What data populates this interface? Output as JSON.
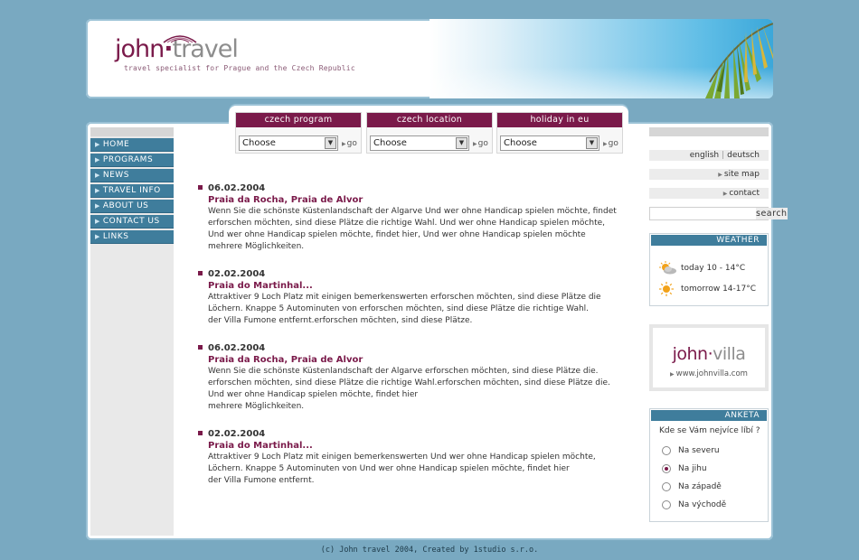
{
  "header": {
    "logo_john": "john",
    "logo_travel": "travel",
    "tagline": "travel specialist for Prague and the Czech Republic"
  },
  "nav": {
    "items": [
      {
        "label": "HOME"
      },
      {
        "label": "PROGRAMS"
      },
      {
        "label": "NEWS"
      },
      {
        "label": "TRAVEL INFO"
      },
      {
        "label": "ABOUT US"
      },
      {
        "label": "CONTACT US"
      },
      {
        "label": "LINKS"
      }
    ]
  },
  "selectors": [
    {
      "title": "czech program",
      "value": "Choose",
      "go": "go"
    },
    {
      "title": "czech location",
      "value": "Choose",
      "go": "go"
    },
    {
      "title": "holiday in eu",
      "value": "Choose",
      "go": "go"
    }
  ],
  "news": [
    {
      "date": "06.02.2004",
      "title": "Praia da Rocha, Praia de Alvor",
      "lines": [
        "Wenn Sie die schönste Küstenlandschaft der Algarve Und wer ohne Handicap spielen möchte, findet",
        "erforschen möchten, sind diese Plätze die richtige Wahl. Und wer ohne Handicap spielen möchte,",
        "Und wer ohne Handicap spielen möchte, findet hier, Und wer ohne Handicap spielen möchte",
        "mehrere Möglichkeiten."
      ]
    },
    {
      "date": "02.02.2004",
      "title": "Praia do Martinhal...",
      "lines": [
        "Attraktiver 9 Loch Platz mit einigen bemerkenswerten erforschen möchten, sind diese Plätze die",
        "Löchern. Knappe 5 Autominuten von erforschen möchten, sind diese Plätze die richtige Wahl.",
        "der Villa Fumone entfernt.erforschen möchten, sind diese Plätze."
      ]
    },
    {
      "date": "06.02.2004",
      "title": "Praia da Rocha, Praia de Alvor",
      "lines": [
        "Wenn Sie die schönste Küstenlandschaft der Algarve erforschen möchten, sind diese Plätze die.",
        "erforschen möchten, sind diese Plätze die richtige Wahl.erforschen möchten, sind diese Plätze die.",
        "Und wer ohne Handicap spielen möchte, findet hier",
        "mehrere Möglichkeiten."
      ]
    },
    {
      "date": "02.02.2004",
      "title": "Praia do Martinhal...",
      "lines": [
        "Attraktiver 9 Loch Platz mit einigen bemerkenswerten Und wer ohne Handicap spielen möchte,",
        "Löchern. Knappe 5 Autominuten von Und wer ohne Handicap spielen möchte, findet hier",
        "der Villa Fumone entfernt."
      ]
    }
  ],
  "right": {
    "lang_en": "english",
    "lang_sep": "|",
    "lang_de": "deutsch",
    "sitemap": "site map",
    "contact": "contact",
    "search_label": "search",
    "search_value": ""
  },
  "weather": {
    "title": "WEATHER",
    "rows": [
      {
        "text": "today 10 - 14°C",
        "icon": "partly-cloudy-icon"
      },
      {
        "text": "tomorrow 14-17°C",
        "icon": "sun-icon"
      }
    ]
  },
  "villa": {
    "logo_john": "john",
    "logo_villa": "villa",
    "url": "www.johnvilla.com"
  },
  "anketa": {
    "title": "ANKETA",
    "question": "Kde se Vám nejvíce líbí ?",
    "options": [
      {
        "label": "Na severu",
        "selected": false
      },
      {
        "label": "Na jihu",
        "selected": true
      },
      {
        "label": "Na západě",
        "selected": false
      },
      {
        "label": "Na východě",
        "selected": false
      }
    ]
  },
  "footer": {
    "text": "(c) John travel 2004, Created by 1studio s.r.o."
  },
  "colors": {
    "background": "#79a9c1",
    "brand": "#7a1a4a",
    "nav": "#3f7d9c"
  }
}
